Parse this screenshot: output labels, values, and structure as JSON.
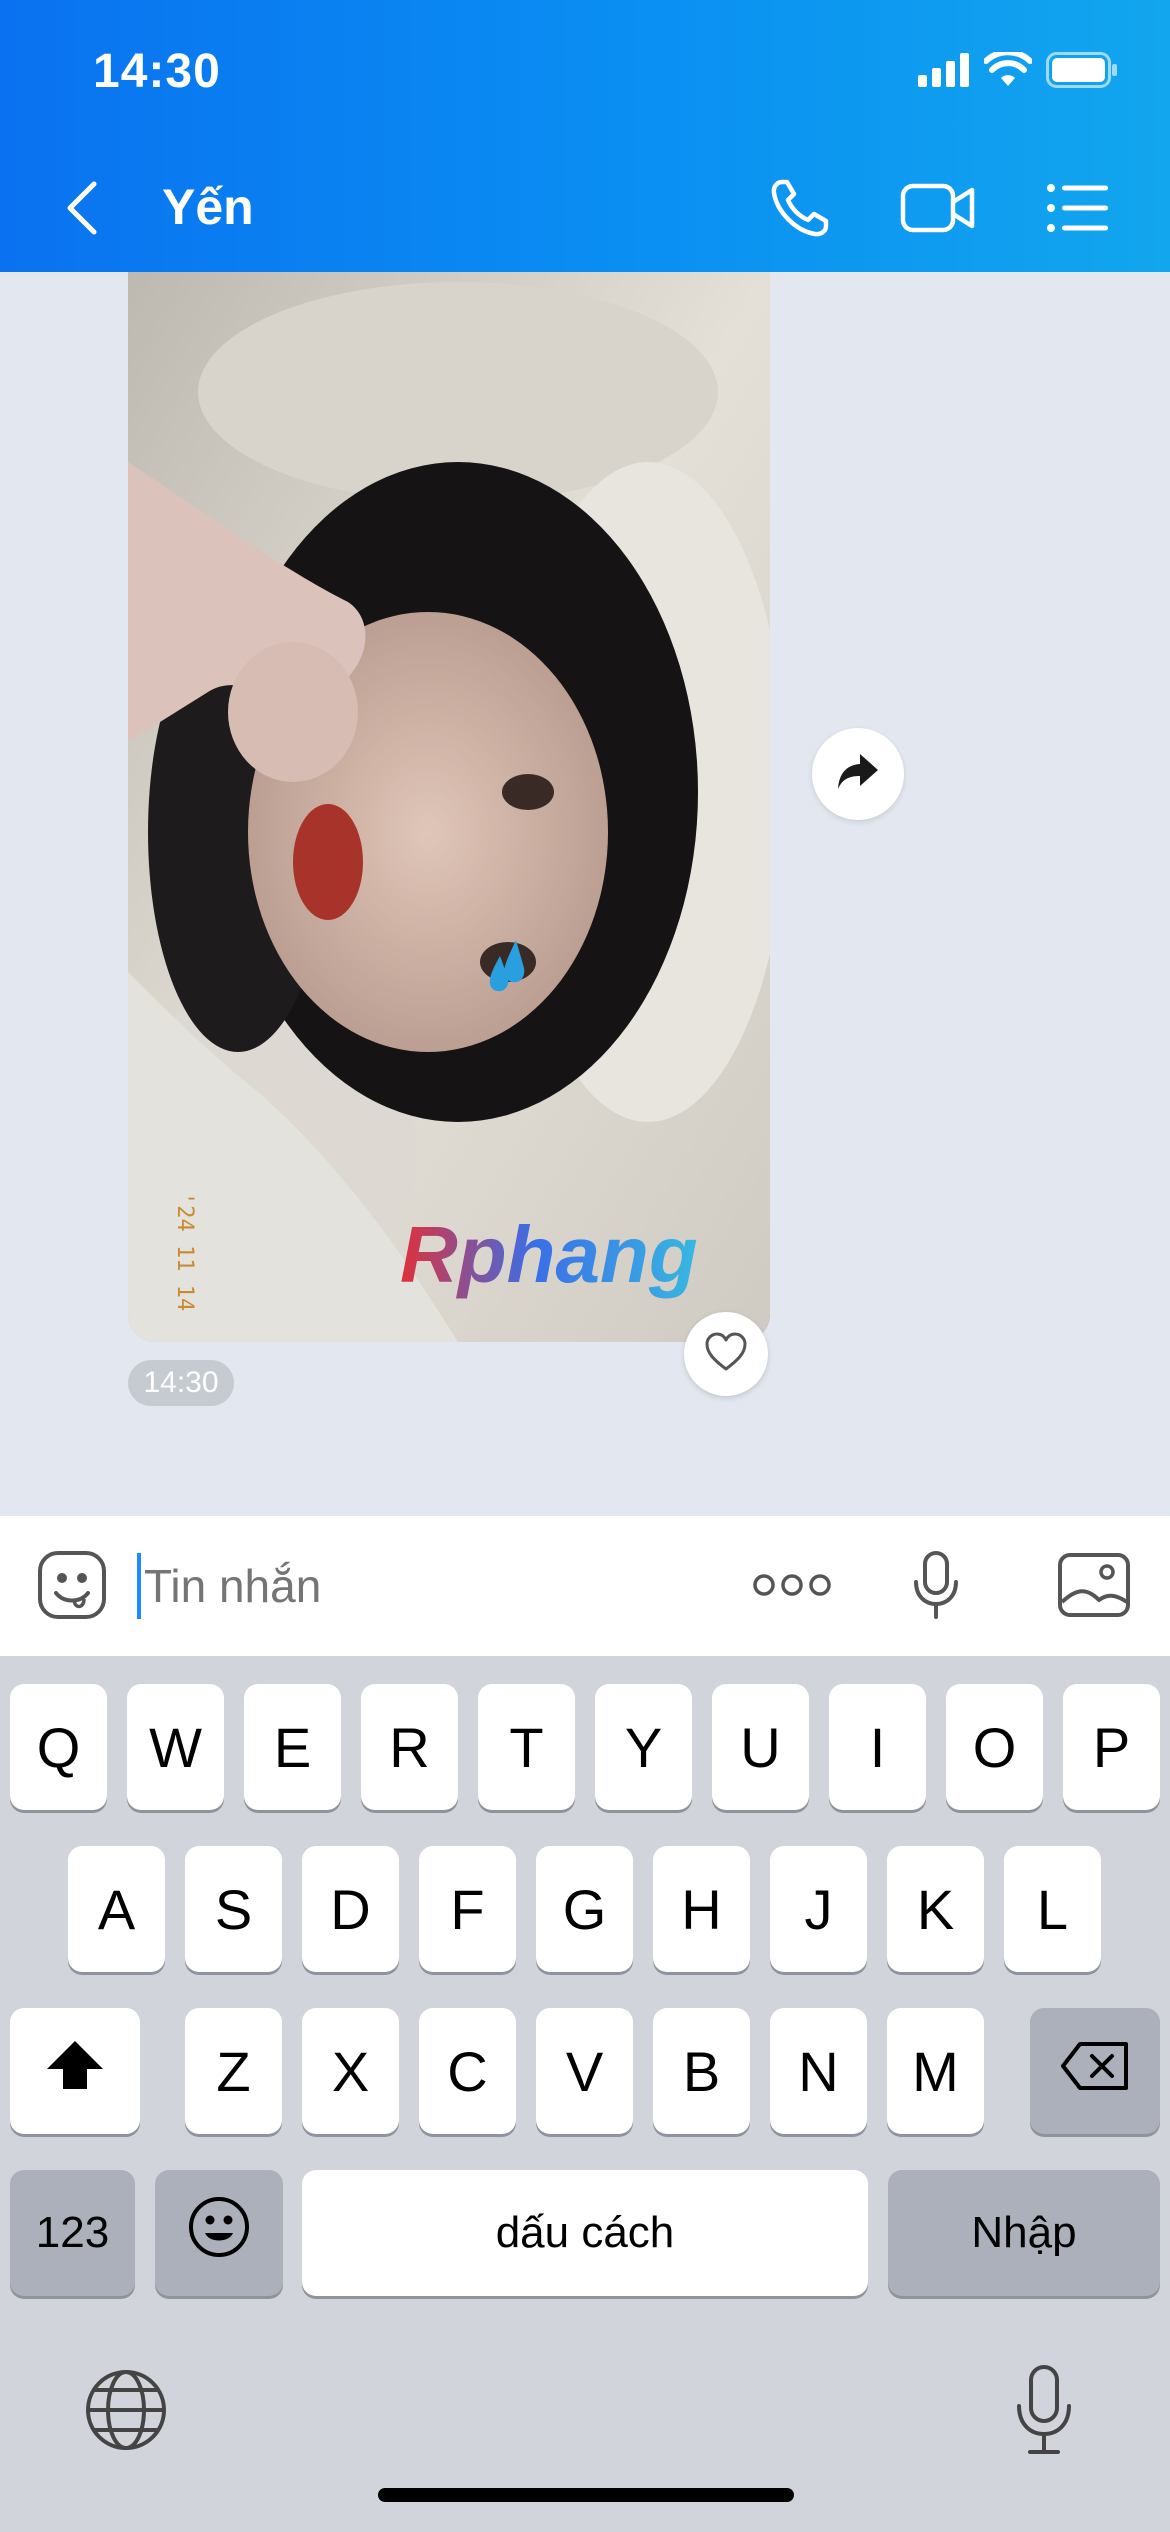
{
  "status_bar": {
    "time": "14:30"
  },
  "header": {
    "contact_name": "Yến"
  },
  "message": {
    "time": "14:30",
    "photo_date_stamp": "'24 11 14",
    "photo_watermark": "Rphang"
  },
  "input": {
    "placeholder": "Tin nhắn"
  },
  "keyboard": {
    "row1": [
      "Q",
      "W",
      "E",
      "R",
      "T",
      "Y",
      "U",
      "I",
      "O",
      "P"
    ],
    "row2": [
      "A",
      "S",
      "D",
      "F",
      "G",
      "H",
      "J",
      "K",
      "L"
    ],
    "row3": [
      "Z",
      "X",
      "C",
      "V",
      "B",
      "N",
      "M"
    ],
    "numbers_label": "123",
    "space_label": "dấu cách",
    "return_label": "Nhập"
  },
  "icons": {
    "signal": "cellular-signal-icon",
    "wifi": "wifi-icon",
    "battery": "battery-icon",
    "back": "chevron-left-icon",
    "call": "phone-icon",
    "video": "video-camera-icon",
    "menu": "list-icon",
    "forward": "share-arrow-icon",
    "like": "heart-icon",
    "sticker": "sticker-face-icon",
    "more": "more-dots-icon",
    "mic": "microphone-icon",
    "gallery": "image-icon",
    "shift": "shift-arrow-icon",
    "delete": "backspace-icon",
    "emoji": "emoji-icon",
    "globe": "globe-icon"
  },
  "colors": {
    "header_start": "#0a72f0",
    "header_end": "#12a6ee",
    "chat_bg": "#e3e8f0",
    "caret": "#1a8cff"
  }
}
